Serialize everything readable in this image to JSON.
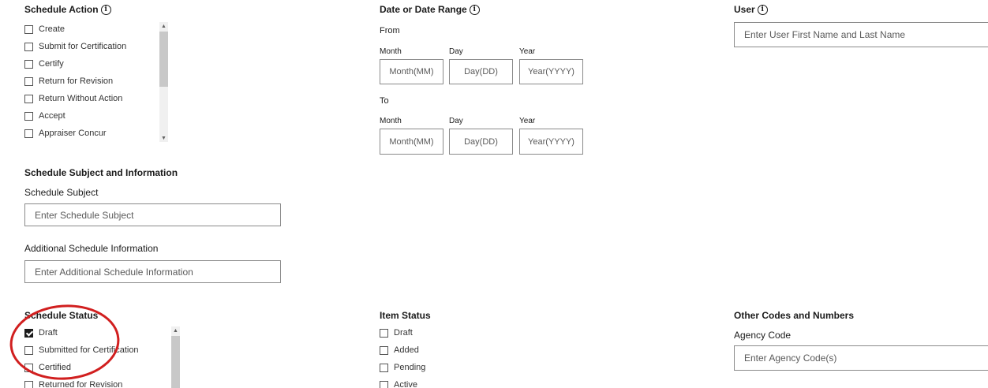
{
  "schedule_action": {
    "heading": "Schedule Action",
    "items": [
      {
        "label": "Create",
        "checked": false
      },
      {
        "label": "Submit for Certification",
        "checked": false
      },
      {
        "label": "Certify",
        "checked": false
      },
      {
        "label": "Return for Revision",
        "checked": false
      },
      {
        "label": "Return Without Action",
        "checked": false
      },
      {
        "label": "Accept",
        "checked": false
      },
      {
        "label": "Appraiser Concur",
        "checked": false
      }
    ]
  },
  "date_range": {
    "heading": "Date or Date Range",
    "from_label": "From",
    "to_label": "To",
    "month_label": "Month",
    "day_label": "Day",
    "year_label": "Year",
    "month_placeholder": "Month(MM)",
    "day_placeholder": "Day(DD)",
    "year_placeholder": "Year(YYYY)"
  },
  "user": {
    "heading": "User",
    "placeholder": "Enter User First Name and Last Name"
  },
  "subject_info": {
    "heading": "Schedule Subject and Information",
    "subject_label": "Schedule Subject",
    "subject_placeholder": "Enter Schedule Subject",
    "additional_label": "Additional Schedule Information",
    "additional_placeholder": "Enter Additional Schedule Information"
  },
  "schedule_status": {
    "heading": "Schedule Status",
    "items": [
      {
        "label": "Draft",
        "checked": true
      },
      {
        "label": "Submitted for Certification",
        "checked": false
      },
      {
        "label": "Certified",
        "checked": false
      },
      {
        "label": "Returned for Revision",
        "checked": false
      }
    ]
  },
  "item_status": {
    "heading": "Item Status",
    "items": [
      {
        "label": "Draft",
        "checked": false
      },
      {
        "label": "Added",
        "checked": false
      },
      {
        "label": "Pending",
        "checked": false
      },
      {
        "label": "Active",
        "checked": false
      }
    ]
  },
  "other_codes": {
    "heading": "Other Codes and Numbers",
    "agency_code_label": "Agency Code",
    "agency_code_placeholder": "Enter Agency Code(s)"
  },
  "colors": {
    "annotation_circle": "#d11f1f",
    "text": "#1b1b1b",
    "border": "#8a8a8a"
  }
}
